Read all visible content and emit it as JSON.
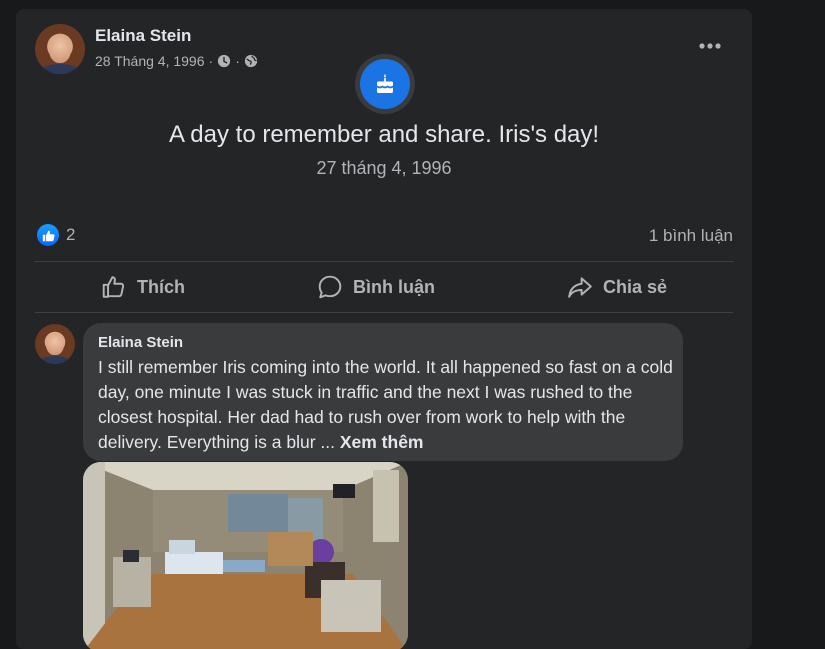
{
  "post": {
    "author": "Elaina Stein",
    "date": "28 Tháng 4, 1996",
    "separator": "·",
    "event_title": "A day to remember and share. Iris's day!",
    "event_date": "27 tháng 4, 1996"
  },
  "stats": {
    "reaction_count": "2",
    "comments": "1 bình luận"
  },
  "actions": {
    "like": "Thích",
    "comment": "Bình luận",
    "share": "Chia sẻ"
  },
  "comment": {
    "author": "Elaina Stein",
    "text": "I still remember Iris coming into the world. It all happened so fast on a cold day, one minute I was stuck in traffic and the next I was rushed to the closest hospital. Her dad had to rush over from work to help with the delivery. Everything is a blur ... ",
    "see_more": "Xem thêm"
  },
  "icons": {
    "privacy": "clock-icon",
    "audience": "globe-icon",
    "event": "cake-icon",
    "reaction": "like-icon"
  },
  "colors": {
    "background": "#18191a",
    "card": "#242526",
    "bubble": "#3a3b3c",
    "accent": "#1b74e4",
    "secondary_text": "#b0b3b8"
  }
}
